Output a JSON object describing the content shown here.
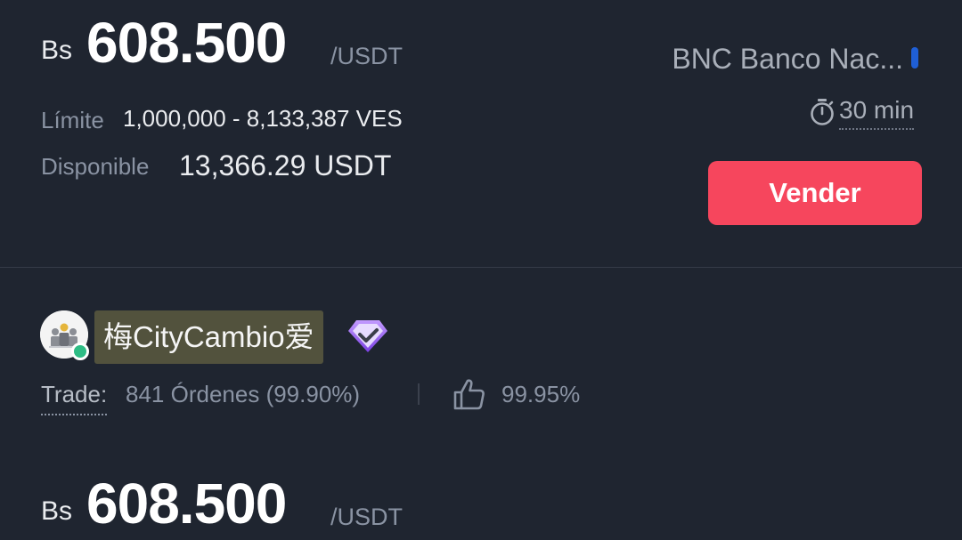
{
  "offer1": {
    "currency": "Bs",
    "price": "608.500",
    "unit": "/USDT",
    "payment_method": "BNC Banco Nac...",
    "payment_color": "#1f5fd6",
    "time_limit": "30 min",
    "limit_label": "Límite",
    "limit_value": "1,000,000 - 8,133,387 VES",
    "available_label": "Disponible",
    "available_value": "13,366.29 USDT",
    "action_label": "Vender",
    "action_color": "#f6465d"
  },
  "merchant": {
    "name": "梅CityCambio爱",
    "status_color": "#2ebd85",
    "badge_icon": "verified-diamond-icon",
    "trade_label": "Trade:",
    "orders": "841 Órdenes",
    "completion": "(99.90%)",
    "rating": "99.95%"
  },
  "offer2": {
    "currency": "Bs",
    "price": "608.500",
    "unit": "/USDT"
  }
}
